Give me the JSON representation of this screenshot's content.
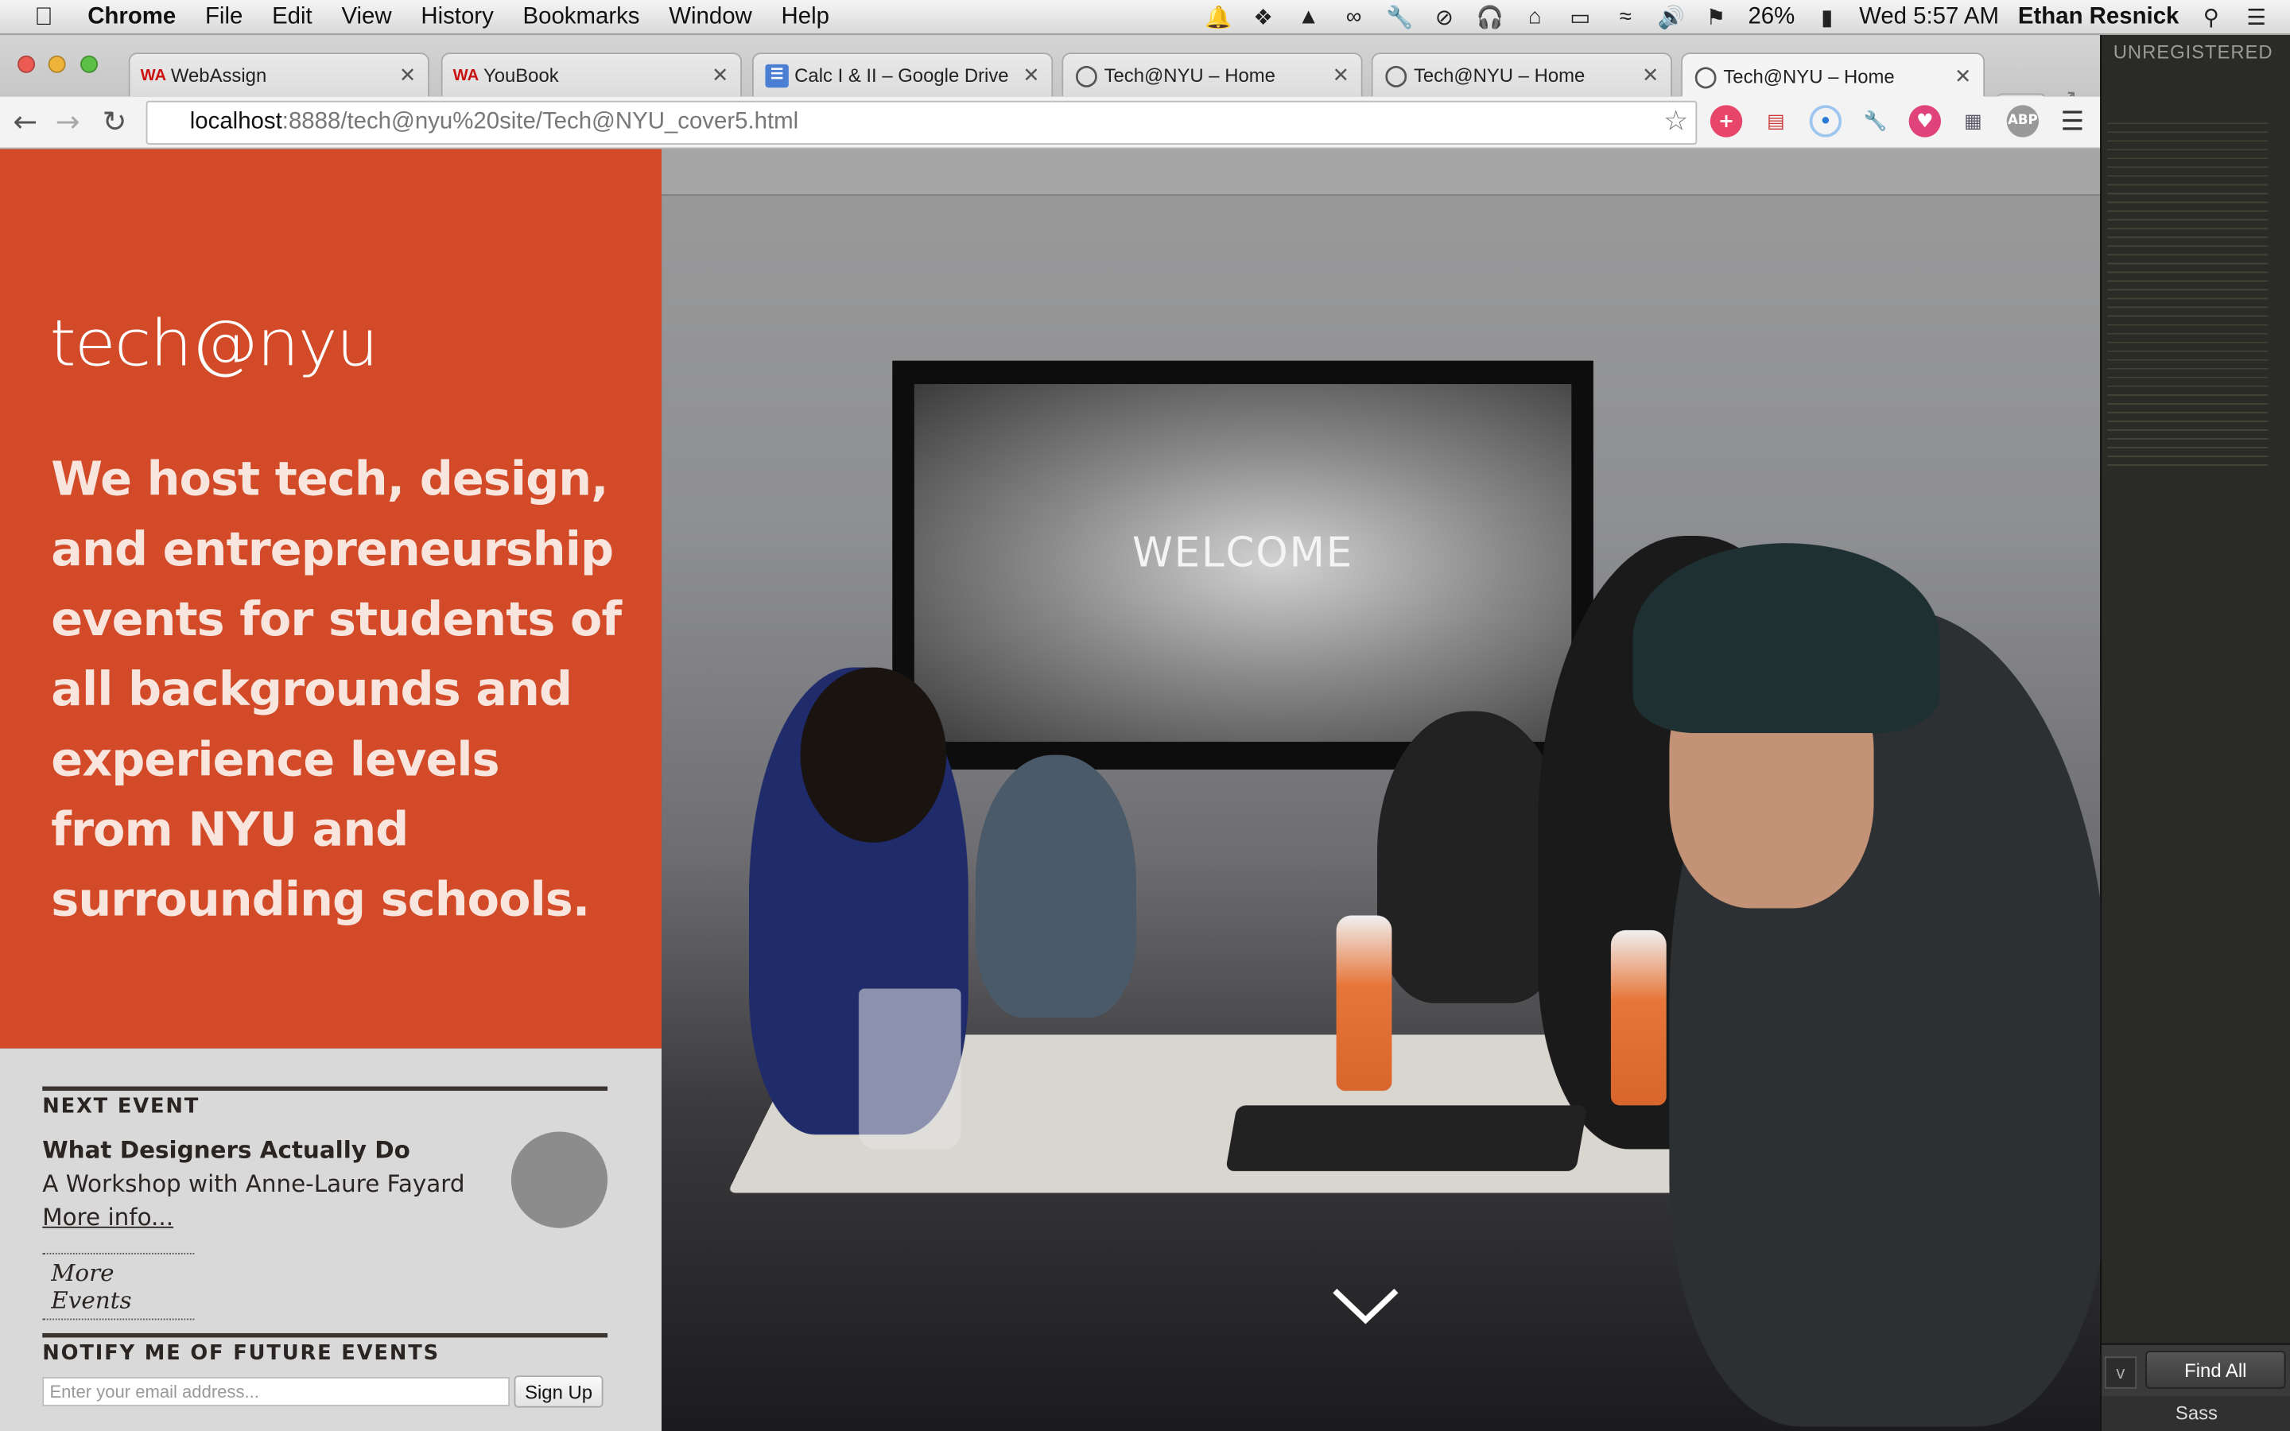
{
  "menubar": {
    "app_name": "Chrome",
    "menus": [
      "File",
      "Edit",
      "View",
      "History",
      "Bookmarks",
      "Window",
      "Help"
    ],
    "battery": "26%",
    "clock": "Wed 5:57 AM",
    "user": "Ethan Resnick"
  },
  "tabs": [
    {
      "label": "WebAssign",
      "icon": "webassign-icon"
    },
    {
      "label": "YouBook",
      "icon": "webassign-icon"
    },
    {
      "label": "Calc I & II – Google Drive",
      "icon": "google-drive-icon"
    },
    {
      "label": "Tech@NYU – Home",
      "icon": "globe-icon"
    },
    {
      "label": "Tech@NYU – Home",
      "icon": "globe-icon"
    },
    {
      "label": "Tech@NYU – Home",
      "icon": "globe-icon",
      "active": true
    }
  ],
  "address_bar": {
    "host": "localhost",
    "rest": ":8888/tech@nyu%20site/Tech@NYU_cover5.html"
  },
  "page": {
    "logo": "tech@nyu",
    "tagline": "We host tech, design, and entrepreneurship events for students of all backgrounds and experience levels from NYU and surrounding schools.",
    "next_event": {
      "heading": "NEXT EVENT",
      "title": "What Designers Actually Do",
      "subtitle": "A Workshop with Anne-Laure Fayard",
      "more_info": "More info...",
      "more_events": "More Events"
    },
    "notify": {
      "heading": "NOTIFY ME OF FUTURE EVENTS",
      "email_placeholder": "Enter your email address...",
      "signup_label": "Sign Up"
    },
    "hero": {
      "screen_text": "WELCOME"
    }
  },
  "editor_panel": {
    "registration": "UNREGISTERED",
    "find_partial": "v",
    "find_all_label": "Find All",
    "syntax": "Sass"
  },
  "colors": {
    "brand_orange": "#d24a27",
    "sidebar_gray": "#d9d9d9"
  }
}
